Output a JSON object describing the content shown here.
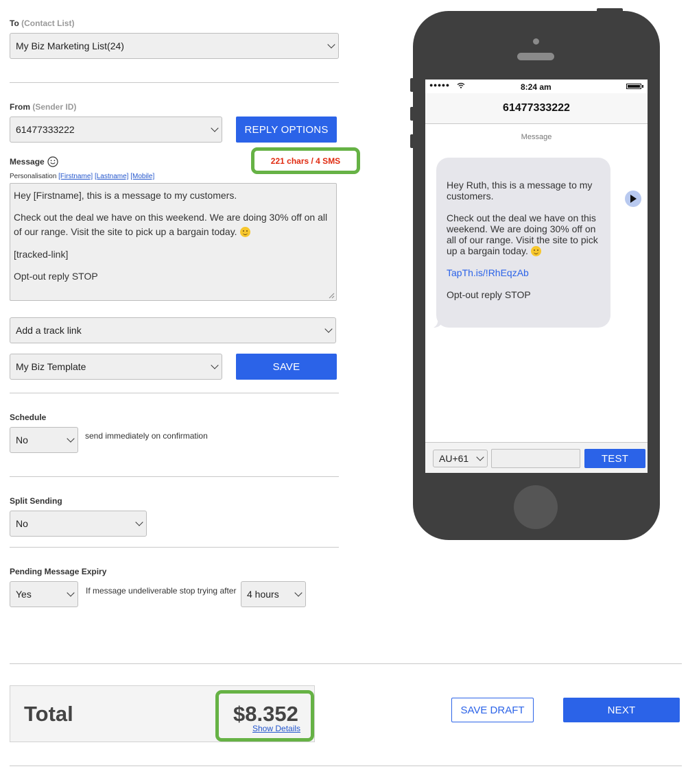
{
  "to": {
    "label": "To",
    "sublabel": "(Contact List)",
    "selected": "My Biz Marketing List",
    "count": "(24)"
  },
  "from": {
    "label": "From",
    "sublabel": "(Sender ID)",
    "selected": "61477333222",
    "reply_button": "REPLY OPTIONS"
  },
  "message": {
    "label": "Message",
    "char_count": "221 chars / 4 SMS",
    "personalisation_label": "Personalisation",
    "tokens": [
      "[Firstname]",
      "[Lastname]",
      "[Mobile]"
    ],
    "lines": [
      "Hey [Firstname], this is a message to my customers.",
      "Check out the deal we have on this weekend. We are doing 30% off on all of our range. Visit the site to pick up a bargain today.",
      "[tracked-link]",
      "Opt-out reply STOP"
    ]
  },
  "track_link": {
    "selected": "Add a track link"
  },
  "template": {
    "selected": "My Biz Template",
    "save_button": "SAVE"
  },
  "schedule": {
    "label": "Schedule",
    "selected": "No",
    "note": "send immediately on confirmation"
  },
  "split": {
    "label": "Split Sending",
    "selected": "No"
  },
  "expiry": {
    "label": "Pending Message Expiry",
    "selected": "Yes",
    "note": "If message undeliverable stop trying after",
    "duration": "4 hours"
  },
  "total": {
    "label": "Total",
    "amount": "$8.352",
    "details_link": "Show Details"
  },
  "actions": {
    "save_draft": "SAVE DRAFT",
    "next": "NEXT"
  },
  "phone": {
    "time": "8:24 am",
    "signal": "●●●●●",
    "number": "61477333222",
    "header": "Message",
    "bubble": {
      "greeting": "Hey Ruth, this is a message to my customers.",
      "body": "Check out the deal we have on this weekend. We are doing 30% off on all of our range. Visit the site to pick up a bargain today.",
      "link": "TapTh.is/!RhEqzAb",
      "optout": "Opt-out reply STOP"
    },
    "country_code": "AU+61",
    "test_button": "TEST"
  },
  "colors": {
    "accent": "#2b63e8",
    "highlight": "#66b245",
    "warning": "#e02a10",
    "phone_body": "#3f3f3f"
  }
}
